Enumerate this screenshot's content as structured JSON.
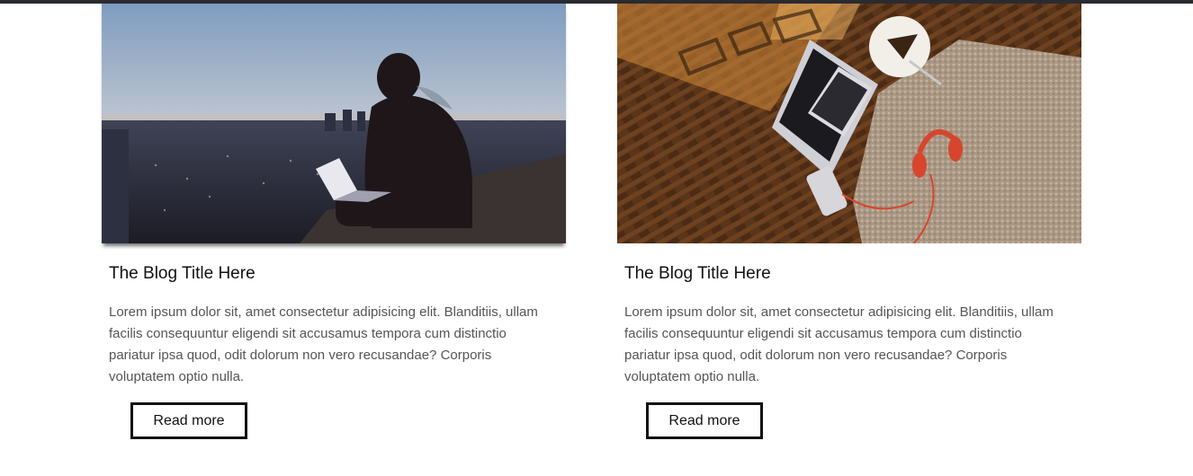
{
  "posts": [
    {
      "image": "photo-person-with-laptop-city-sunset",
      "title": "The Blog Title Here",
      "excerpt": "Lorem ipsum dolor sit, amet consectetur adipisicing elit. Blanditiis, ullam facilis consequuntur eligendi sit accusamus tempora cum distinctio pariatur ipsa quod, odit dolorum non vero recusandae? Corporis voluptatem optio nulla.",
      "button_label": "Read more"
    },
    {
      "image": "photo-laptop-on-wooden-floor-with-headphones",
      "title": "The Blog Title Here",
      "excerpt": "Lorem ipsum dolor sit, amet consectetur adipisicing elit. Blanditiis, ullam facilis consequuntur eligendi sit accusamus tempora cum distinctio pariatur ipsa quod, odit dolorum non vero recusandae? Corporis voluptatem optio nulla.",
      "button_label": "Read more"
    }
  ],
  "colors": {
    "top_bar": "#2a2b30",
    "title": "#111111",
    "body_text": "#555555",
    "button_border": "#111111"
  }
}
